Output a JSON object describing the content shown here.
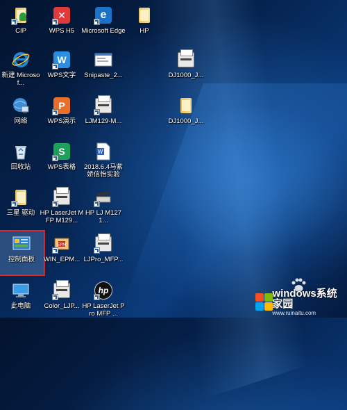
{
  "desktop": {
    "icons": [
      {
        "label": "CIP",
        "icon": "folder-user-icon"
      },
      {
        "label": "WPS H5",
        "icon": "wps-h5-icon"
      },
      {
        "label": "Microsoft Edge",
        "icon": "edge-icon"
      },
      {
        "label": "HP",
        "icon": "folder-icon"
      },
      {
        "label": "新建 Microsof...",
        "icon": "ie-icon"
      },
      {
        "label": "WPS文字",
        "icon": "wps-writer-icon"
      },
      {
        "label": "Snipaste_2...",
        "icon": "image-file-icon"
      },
      {
        "label": "DJ1000_J...",
        "icon": "printer-icon"
      },
      {
        "label": "网络",
        "icon": "network-icon"
      },
      {
        "label": "WPS演示",
        "icon": "wps-presentation-icon"
      },
      {
        "label": "LJM129-M...",
        "icon": "printer-icon"
      },
      {
        "label": "DJ1000_J...",
        "icon": "folder-icon"
      },
      {
        "label": "回收站",
        "icon": "recycle-bin-icon"
      },
      {
        "label": "WPS表格",
        "icon": "wps-spreadsheet-icon"
      },
      {
        "label": "2018.6.4马紫娇信怡实验",
        "icon": "word-document-icon"
      },
      {
        "label": "三星 驱动",
        "icon": "folder-icon"
      },
      {
        "label": "HP LaserJet MFP M129...",
        "icon": "printer-icon"
      },
      {
        "label": "HP LJ M1271...",
        "icon": "scanner-icon"
      },
      {
        "label": "控制面板",
        "icon": "control-panel-icon"
      },
      {
        "label": "WIN_EPM...",
        "icon": "installer-icon"
      },
      {
        "label": "LJPro_MFP...",
        "icon": "printer-icon"
      },
      {
        "label": "此电脑",
        "icon": "this-pc-icon"
      },
      {
        "label": "Color_LJP...",
        "icon": "printer-icon"
      },
      {
        "label": "HP LaserJet Pro MFP ...",
        "icon": "hp-logo-icon"
      }
    ],
    "selected_label": "控制面板"
  },
  "watermark": {
    "brand": "windows",
    "site": "windows系统家园",
    "url": "www.ruinaitu.com"
  },
  "colors": {
    "selection_border": "#d8242b",
    "wallpaper": "#0a3a7a"
  }
}
